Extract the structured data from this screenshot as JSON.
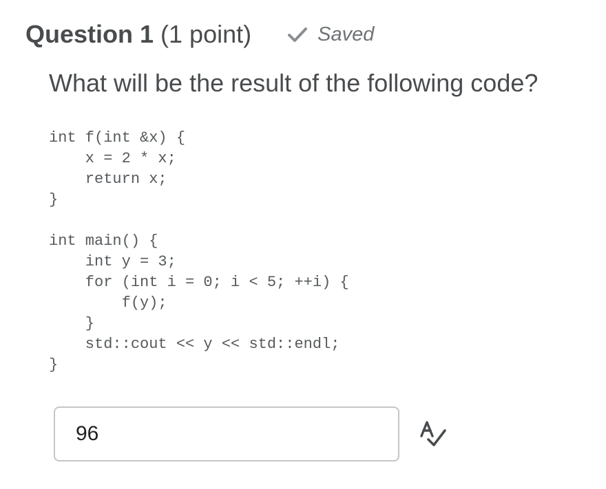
{
  "question": {
    "title": "Question 1",
    "points": "(1 point)",
    "status": {
      "icon": "check-icon",
      "label": "Saved",
      "color": "#8a8e91"
    },
    "prompt": "What will be the result of the following code?",
    "code_lines": [
      "int f(int &x) {",
      "    x = 2 * x;",
      "    return x;",
      "}",
      "",
      "int main() {",
      "    int y = 3;",
      "    for (int i = 0; i < 5; ++i) {",
      "        f(y);",
      "    }",
      "    std::cout << y << std::endl;",
      "}"
    ]
  },
  "answer": {
    "value": "96",
    "tool_icon": "spellcheck-icon"
  }
}
